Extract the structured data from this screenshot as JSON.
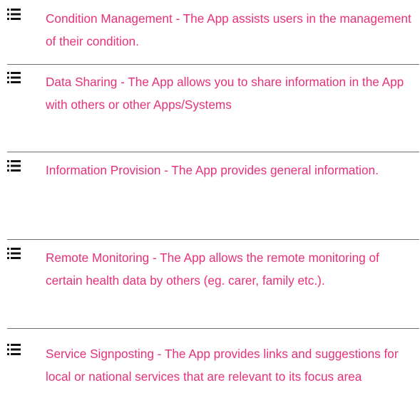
{
  "features": {
    "items": [
      {
        "icon": "list-icon",
        "text": "Condition Management - The App assists users in the management of their condition."
      },
      {
        "icon": "list-icon",
        "text": "Data Sharing - The App allows you to share information in the App with others or other Apps/Systems"
      },
      {
        "icon": "list-icon",
        "text": "Information Provision - The App provides general information."
      },
      {
        "icon": "list-icon",
        "text": "Remote Monitoring - The App allows the remote monitoring of certain health data by others (eg. carer, family etc.)."
      },
      {
        "icon": "list-icon",
        "text": "Service Signposting - The App provides links and suggestions for local or national services that are relevant to its focus area"
      }
    ]
  },
  "colors": {
    "text": "#e6317a",
    "icon": "#111111",
    "divider": "#6f6f6f"
  }
}
